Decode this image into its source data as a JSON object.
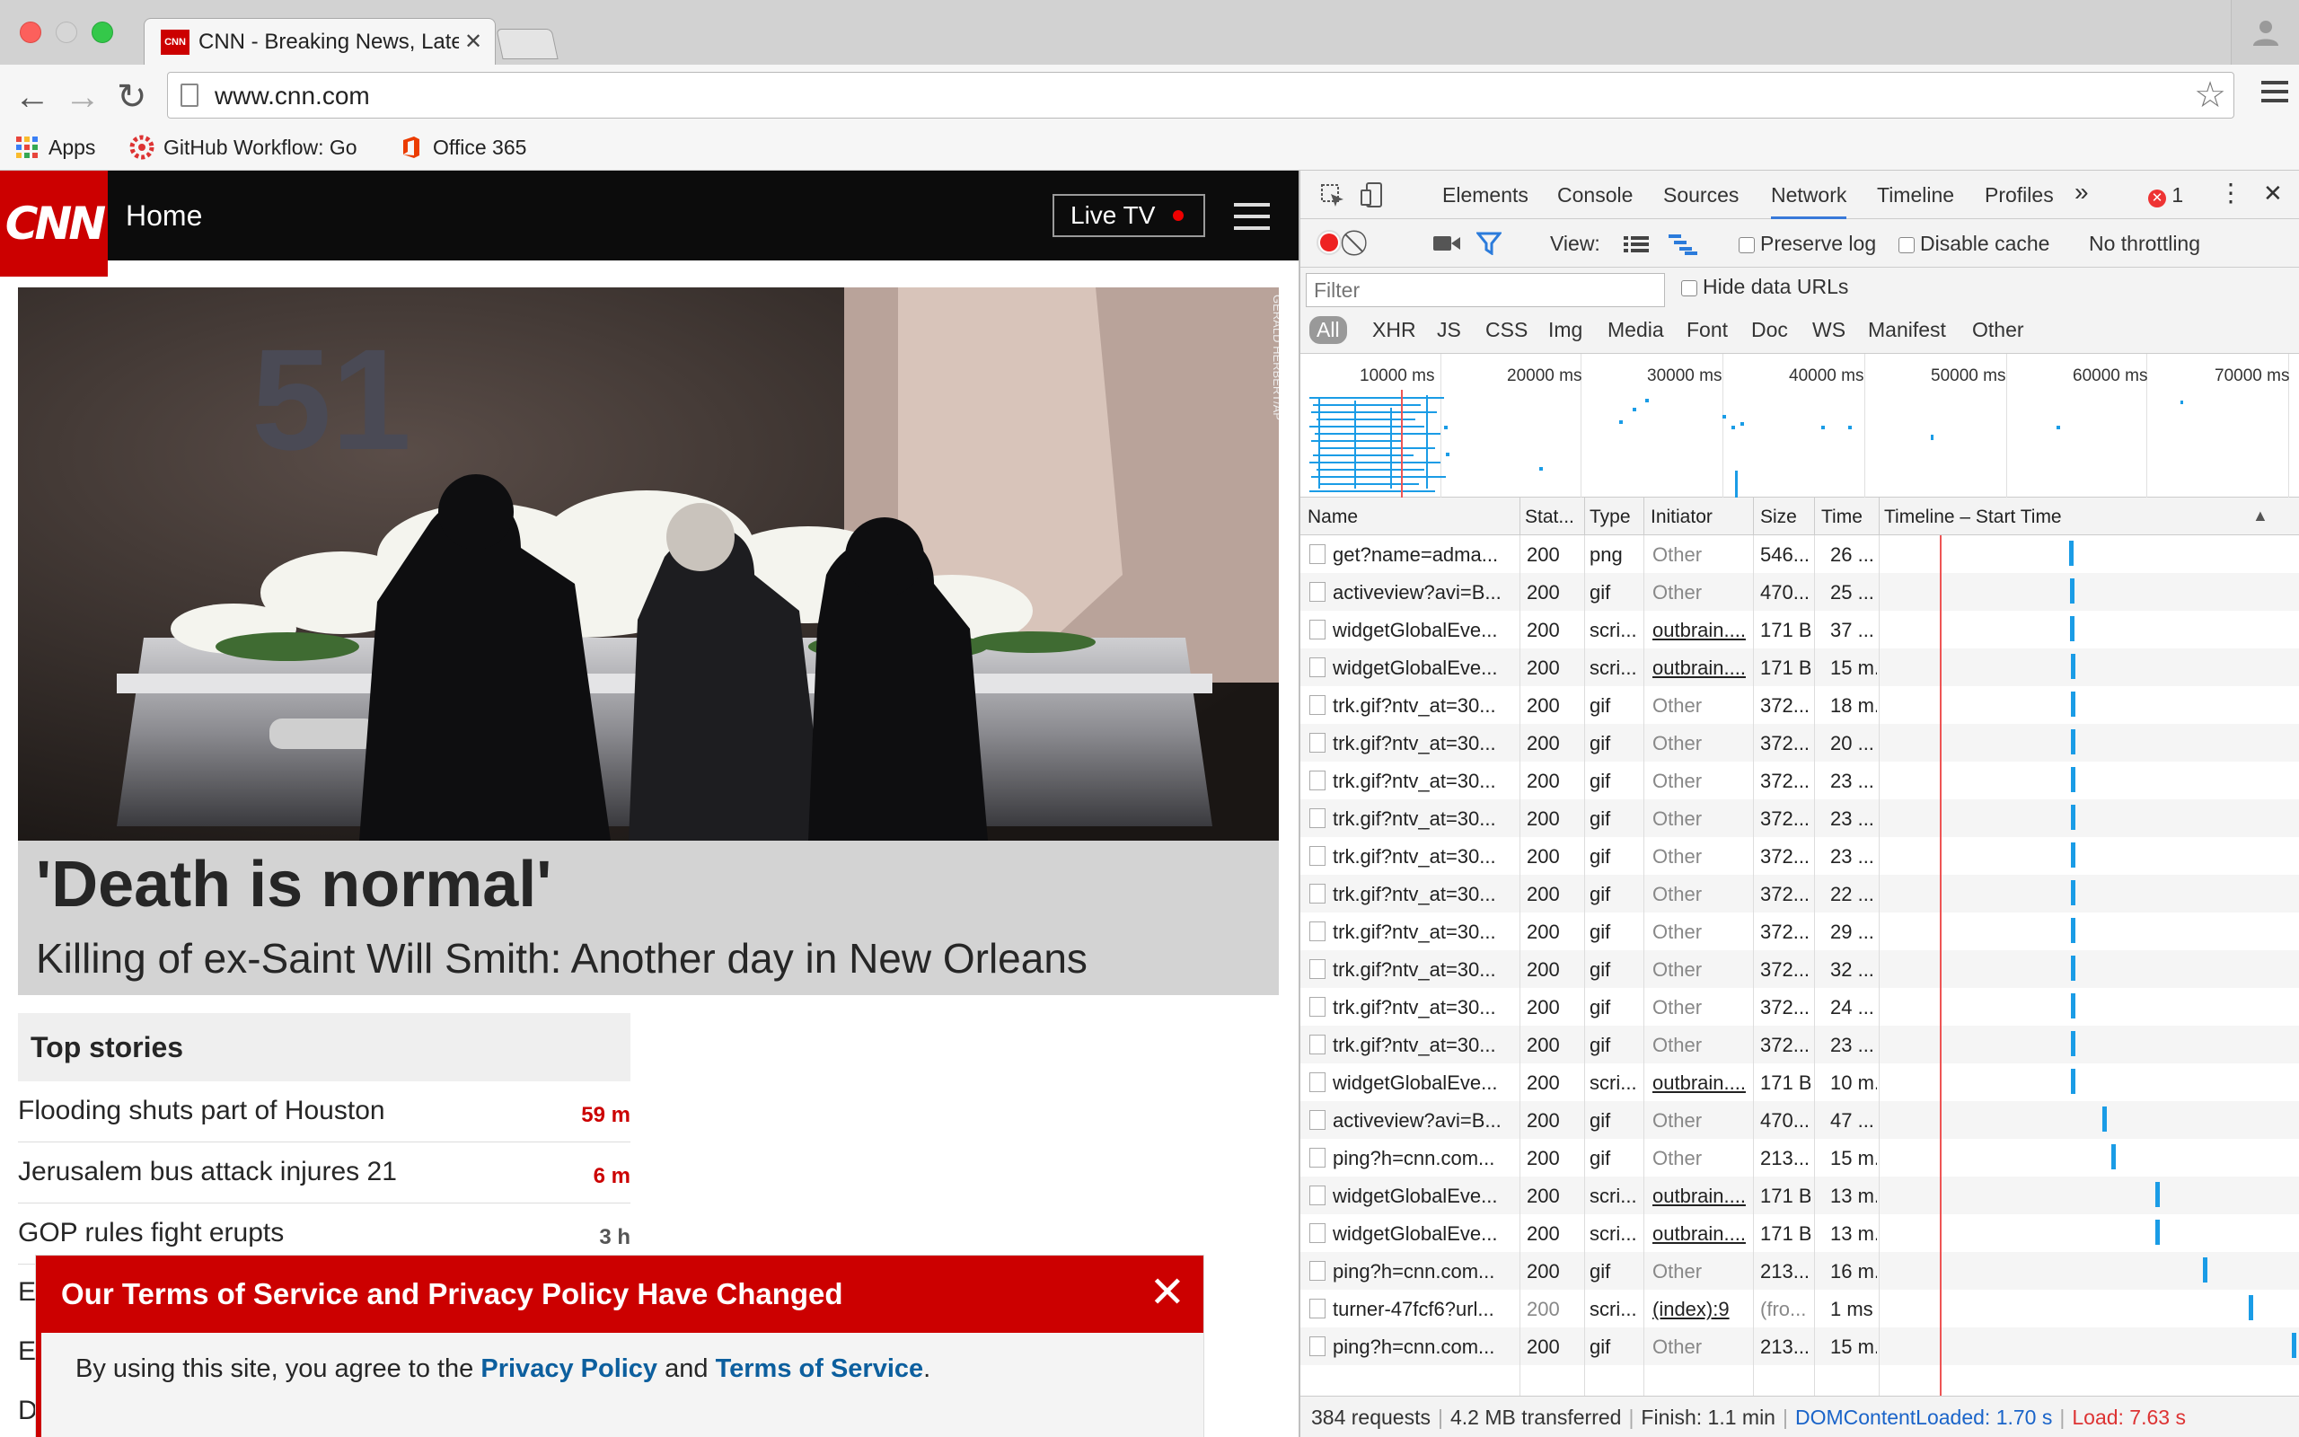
{
  "browser": {
    "tab_title": "CNN - Breaking News, Latest News and Videos",
    "tab_favicon_text": "CNN",
    "url": "www.cnn.com",
    "bookmarks": [
      {
        "label": "Apps",
        "icon": "apps-grid-icon"
      },
      {
        "label": "GitHub Workflow: Go",
        "icon": "github-workflow-icon"
      },
      {
        "label": "Office 365",
        "icon": "office-365-icon"
      }
    ]
  },
  "cnn": {
    "logo": "CNN",
    "home_label": "Home",
    "live_tv_label": "Live TV",
    "hero_credit": "GERALD HERBERT/AP",
    "hero_title": "'Death is normal'",
    "hero_subtitle": "Killing of ex-Saint Will Smith: Another day in New Orleans",
    "top_stories_header": "Top stories",
    "stories": [
      {
        "title": "Flooding shuts part of Houston",
        "age": "59 m",
        "age_color": "#cc0000"
      },
      {
        "title": "Jerusalem bus attack injures 21",
        "age": "6 m",
        "age_color": "#cc0000"
      },
      {
        "title": "GOP rules fight erupts",
        "age": "3 h",
        "age_color": "#555555"
      }
    ],
    "hidden_fragments": [
      "E",
      "E",
      "D"
    ],
    "tos_title": "Our Terms of Service and Privacy Policy Have Changed",
    "tos_text_1": "By using this site, you agree to the ",
    "tos_privacy_link": "Privacy Policy",
    "tos_text_2": " and ",
    "tos_terms_link": "Terms of Service",
    "tos_text_3": ".",
    "brand_color": "#cc0000"
  },
  "devtools": {
    "tabs": [
      "Elements",
      "Console",
      "Sources",
      "Network",
      "Timeline",
      "Profiles"
    ],
    "active_tab": "Network",
    "more_tabs": "»",
    "error_count": "1",
    "toolbar": {
      "view_label": "View:",
      "preserve_log": "Preserve log",
      "disable_cache": "Disable cache",
      "throttling": "No throttling"
    },
    "filter_placeholder": "Filter",
    "hide_data_urls": "Hide data URLs",
    "filter_types": [
      "All",
      "XHR",
      "JS",
      "CSS",
      "Img",
      "Media",
      "Font",
      "Doc",
      "WS",
      "Manifest",
      "Other"
    ],
    "overview_ticks": [
      "10000 ms",
      "20000 ms",
      "30000 ms",
      "40000 ms",
      "50000 ms",
      "60000 ms",
      "70000 ms"
    ],
    "columns": [
      "Name",
      "Stat...",
      "Type",
      "Initiator",
      "Size",
      "Time",
      "Timeline – Start Time"
    ],
    "sort_indicator": "▲",
    "rows": [
      {
        "name": "get?name=adma...",
        "status": "200",
        "type": "png",
        "initiator": "Other",
        "size": "546...",
        "time": "26 ...",
        "start": 0.455
      },
      {
        "name": "activeview?avi=B...",
        "status": "200",
        "type": "gif",
        "initiator": "Other",
        "size": "470...",
        "time": "25 ...",
        "start": 0.457
      },
      {
        "name": "widgetGlobalEve...",
        "status": "200",
        "type": "scri...",
        "initiator": "outbrain....",
        "size": "171 B",
        "time": "37 ...",
        "start": 0.458
      },
      {
        "name": "widgetGlobalEve...",
        "status": "200",
        "type": "scri...",
        "initiator": "outbrain....",
        "size": "171 B",
        "time": "15 m...",
        "start": 0.459
      },
      {
        "name": "trk.gif?ntv_at=30...",
        "status": "200",
        "type": "gif",
        "initiator": "Other",
        "size": "372...",
        "time": "18 m...",
        "start": 0.459
      },
      {
        "name": "trk.gif?ntv_at=30...",
        "status": "200",
        "type": "gif",
        "initiator": "Other",
        "size": "372...",
        "time": "20 ...",
        "start": 0.459
      },
      {
        "name": "trk.gif?ntv_at=30...",
        "status": "200",
        "type": "gif",
        "initiator": "Other",
        "size": "372...",
        "time": "23 ...",
        "start": 0.459
      },
      {
        "name": "trk.gif?ntv_at=30...",
        "status": "200",
        "type": "gif",
        "initiator": "Other",
        "size": "372...",
        "time": "23 ...",
        "start": 0.459
      },
      {
        "name": "trk.gif?ntv_at=30...",
        "status": "200",
        "type": "gif",
        "initiator": "Other",
        "size": "372...",
        "time": "23 ...",
        "start": 0.459
      },
      {
        "name": "trk.gif?ntv_at=30...",
        "status": "200",
        "type": "gif",
        "initiator": "Other",
        "size": "372...",
        "time": "22 ...",
        "start": 0.459
      },
      {
        "name": "trk.gif?ntv_at=30...",
        "status": "200",
        "type": "gif",
        "initiator": "Other",
        "size": "372...",
        "time": "29 ...",
        "start": 0.459
      },
      {
        "name": "trk.gif?ntv_at=30...",
        "status": "200",
        "type": "gif",
        "initiator": "Other",
        "size": "372...",
        "time": "32 ...",
        "start": 0.459
      },
      {
        "name": "trk.gif?ntv_at=30...",
        "status": "200",
        "type": "gif",
        "initiator": "Other",
        "size": "372...",
        "time": "24 ...",
        "start": 0.459
      },
      {
        "name": "trk.gif?ntv_at=30...",
        "status": "200",
        "type": "gif",
        "initiator": "Other",
        "size": "372...",
        "time": "23 ...",
        "start": 0.459
      },
      {
        "name": "widgetGlobalEve...",
        "status": "200",
        "type": "scri...",
        "initiator": "outbrain....",
        "size": "171 B",
        "time": "10 m...",
        "start": 0.46
      },
      {
        "name": "activeview?avi=B...",
        "status": "200",
        "type": "gif",
        "initiator": "Other",
        "size": "470...",
        "time": "47 ...",
        "start": 0.535
      },
      {
        "name": "ping?h=cnn.com...",
        "status": "200",
        "type": "gif",
        "initiator": "Other",
        "size": "213...",
        "time": "15 m...",
        "start": 0.555
      },
      {
        "name": "widgetGlobalEve...",
        "status": "200",
        "type": "scri...",
        "initiator": "outbrain....",
        "size": "171 B",
        "time": "13 m...",
        "start": 0.66
      },
      {
        "name": "widgetGlobalEve...",
        "status": "200",
        "type": "scri...",
        "initiator": "outbrain....",
        "size": "171 B",
        "time": "13 m...",
        "start": 0.66
      },
      {
        "name": "ping?h=cnn.com...",
        "status": "200",
        "type": "gif",
        "initiator": "Other",
        "size": "213...",
        "time": "16 m...",
        "start": 0.775
      },
      {
        "name": "turner-47fcf6?url...",
        "status": "200",
        "type": "scri...",
        "initiator": "(index):9",
        "size": "(fro...",
        "time": "1 ms",
        "start": 0.885
      },
      {
        "name": "ping?h=cnn.com...",
        "status": "200",
        "type": "gif",
        "initiator": "Other",
        "size": "213...",
        "time": "15 m...",
        "start": 0.988
      }
    ],
    "summary": {
      "requests": "384 requests",
      "transferred": "4.2 MB transferred",
      "finish": "Finish: 1.1 min",
      "dom_content_loaded": "DOMContentLoaded: 1.70 s",
      "load": "Load: 7.63 s"
    }
  }
}
